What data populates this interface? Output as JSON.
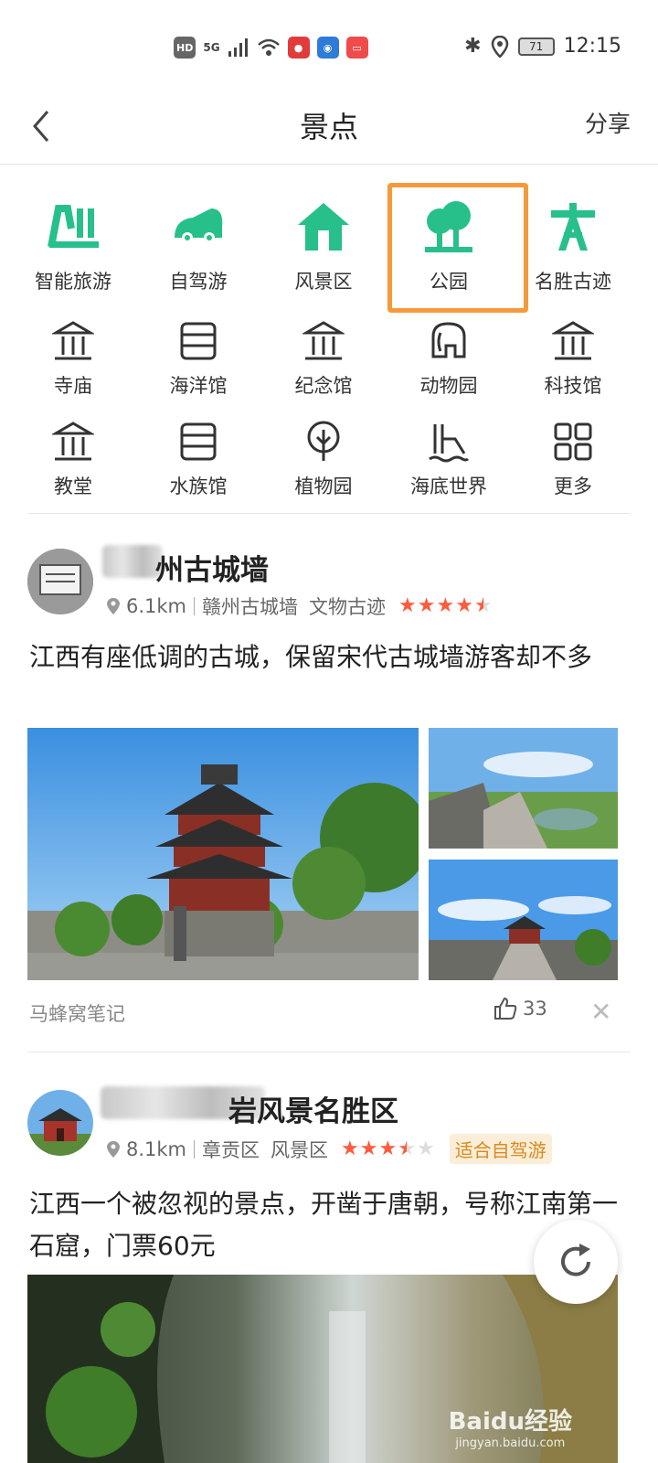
{
  "status_bar": {
    "hd": "HD",
    "signal": "5G",
    "battery": "71",
    "time": "12:15"
  },
  "header": {
    "title": "景点",
    "share_label": "分享"
  },
  "categories": [
    {
      "label": "智能旅游",
      "icon": "smart-travel-icon"
    },
    {
      "label": "自驾游",
      "icon": "car-icon"
    },
    {
      "label": "风景区",
      "icon": "house-icon"
    },
    {
      "label": "公园",
      "icon": "tree-icon"
    },
    {
      "label": "名胜古迹",
      "icon": "monument-icon"
    },
    {
      "label": "寺庙",
      "icon": "temple-icon"
    },
    {
      "label": "海洋馆",
      "icon": "aquarium-icon"
    },
    {
      "label": "纪念馆",
      "icon": "memorial-icon"
    },
    {
      "label": "动物园",
      "icon": "elephant-icon"
    },
    {
      "label": "科技馆",
      "icon": "museum-icon"
    },
    {
      "label": "教堂",
      "icon": "church-icon"
    },
    {
      "label": "水族馆",
      "icon": "aquarium-icon"
    },
    {
      "label": "植物园",
      "icon": "plant-icon"
    },
    {
      "label": "海底世界",
      "icon": "underwater-icon"
    },
    {
      "label": "更多",
      "icon": "grid-icon"
    }
  ],
  "colors": {
    "accent": "#27c08b",
    "highlight": "#f59a3b",
    "star": "#ff5a3c"
  },
  "posts": [
    {
      "title": "州古城墙",
      "distance": "6.1km",
      "area": "赣州古城墙",
      "type": "文物古迹",
      "rating": 4.5,
      "description": "江西有座低调的古城，保留宋代古城墙游客却不多",
      "source": "马蜂窝笔记",
      "likes": "33"
    },
    {
      "title": "岩风景名胜区",
      "distance": "8.1km",
      "area": "章贡区",
      "type": "风景区",
      "rating": 3.5,
      "tag": "适合自驾游",
      "description": "江西一个被忽视的景点，开凿于唐朝，号称江南第一石窟，门票60元"
    }
  ],
  "watermark": {
    "brand": "Baidu经验",
    "url": "jingyan.baidu.com"
  }
}
